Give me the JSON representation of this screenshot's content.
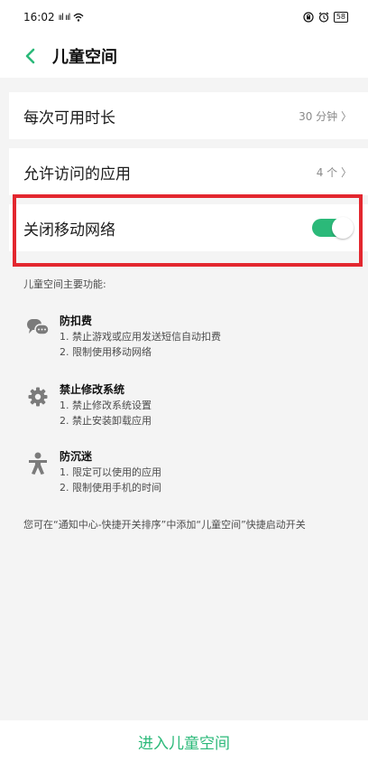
{
  "status_bar": {
    "time": "16:02",
    "signal": "ııl ııl",
    "battery": "58"
  },
  "header": {
    "title": "儿童空间"
  },
  "settings": {
    "duration_label": "每次可用时长",
    "duration_value": "30 分钟 〉",
    "apps_label": "允许访问的应用",
    "apps_value": "4 个 〉",
    "network_label": "关闭移动网络",
    "network_enabled": true
  },
  "features": {
    "section_title": "儿童空间主要功能:",
    "items": [
      {
        "icon": "chat-bubbles-icon",
        "title": "防扣费",
        "line1": "1. 禁止游戏或应用发送短信自动扣费",
        "line2": "2. 限制使用移动网络"
      },
      {
        "icon": "gear-icon",
        "title": "禁止修改系统",
        "line1": "1. 禁止修改系统设置",
        "line2": "2. 禁止安装卸载应用"
      },
      {
        "icon": "person-icon",
        "title": "防沉迷",
        "line1": "1. 限定可以使用的应用",
        "line2": "2. 限制使用手机的时间"
      }
    ],
    "hint": "您可在“通知中心-快捷开关排序”中添加“儿童空间”快捷启动开关"
  },
  "bottom": {
    "enter_label": "进入儿童空间"
  },
  "colors": {
    "accent": "#2bb979",
    "highlight": "#e3272f"
  }
}
